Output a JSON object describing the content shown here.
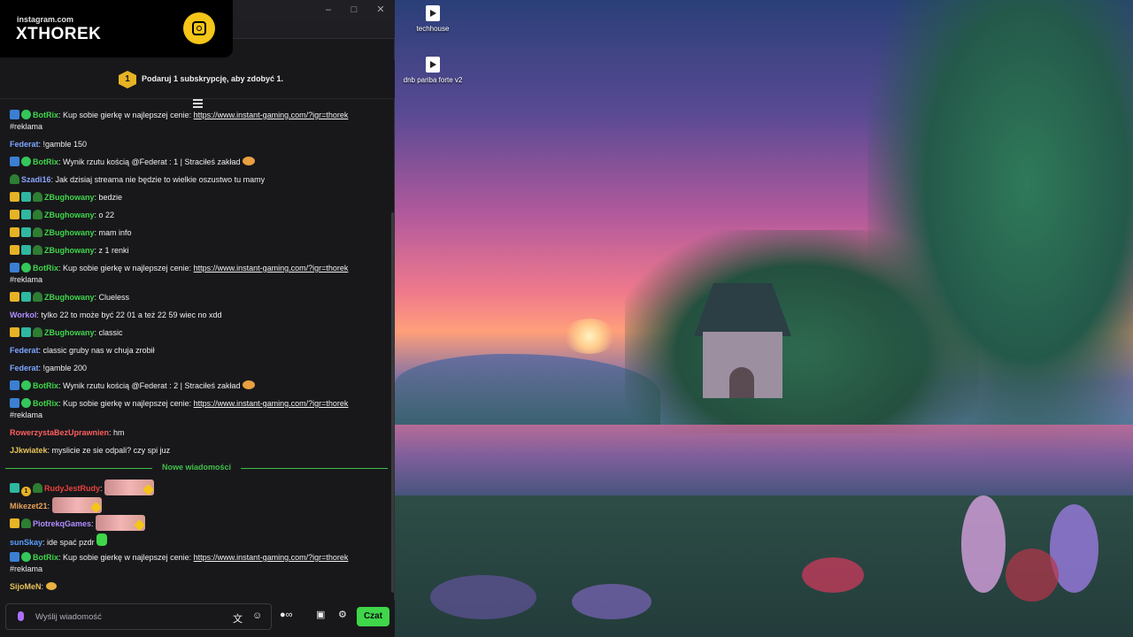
{
  "overlay": {
    "small": "instagram.com",
    "big": "XTHOREK",
    "logo_icon": "instagram-icon"
  },
  "gift": {
    "badge": "1",
    "text": "Podaruj 1 subskrypcję, aby zdobyć 1."
  },
  "desktop": {
    "icons": [
      {
        "label": "techhouse",
        "icon": "media-file-icon"
      },
      {
        "label": "dnb pariba forte v2",
        "icon": "media-file-icon"
      }
    ]
  },
  "colors": {
    "botrix": "#3fd64a",
    "federat": "#7ea6ff",
    "zbugh": "#3fd64a",
    "szadi": "#8aa6ff",
    "workol": "#b08cff",
    "rower": "#ff5e5e",
    "jjk": "#e8c35a",
    "rudy": "#e8413c",
    "mikezet": "#e8a35a",
    "piotrek": "#b08cff",
    "sunskay": "#5aa0ff",
    "sijomen": "#e8c35a",
    "accent": "#3fd64a"
  },
  "messages": [
    {
      "user": "BotRix",
      "text": "Kup sobie gierkę w najlepszej cenie: ",
      "link": "https://www.instant-gaming.com/?igr=thorek",
      "cont": "#reklama"
    },
    {
      "user": "Federat",
      "text": "!gamble 150"
    },
    {
      "user": "BotRix",
      "text": "Wynik rzutu kością @Federat : 1 | Straciłeś zakład"
    },
    {
      "user": "Szadi16",
      "text": "Jak dzisiaj streama nie będzie to wielkie oszustwo tu mamy"
    },
    {
      "user": "ZBughowany",
      "text": "bedzie"
    },
    {
      "user": "ZBughowany",
      "text": "o 22"
    },
    {
      "user": "ZBughowany",
      "text": "mam info"
    },
    {
      "user": "ZBughowany",
      "text": "z 1 renki"
    },
    {
      "user": "BotRix",
      "text": "Kup sobie gierkę w najlepszej cenie: ",
      "link": "https://www.instant-gaming.com/?igr=thorek",
      "cont": "#reklama"
    },
    {
      "user": "ZBughowany",
      "text": "Clueless"
    },
    {
      "user": "Workol",
      "text": "tylko 22 to może być 22 01 a też 22 59 wiec no xdd"
    },
    {
      "user": "ZBughowany",
      "text": "classic"
    },
    {
      "user": "Federat",
      "text": "classic gruby nas w chuja zrobił"
    },
    {
      "user": "Federat",
      "text": "!gamble 200"
    },
    {
      "user": "BotRix",
      "text": "Wynik rzutu kością @Federat : 2 | Straciłeś zakład"
    },
    {
      "user": "BotRix",
      "text": "Kup sobie gierkę w najlepszej cenie: ",
      "link": "https://www.instant-gaming.com/?igr=thorek",
      "cont": "#reklama"
    },
    {
      "user": "RowerzystaBezUprawnien",
      "text": "hm"
    },
    {
      "user": "JJkwiatek",
      "text": "myslicie ze sie odpali? czy spi juz"
    },
    {
      "user": "RudyJestRudy",
      "text": ""
    },
    {
      "user": "Mikezet21",
      "text": ""
    },
    {
      "user": "PiotrekqGames",
      "text": ""
    },
    {
      "user": "sunSkay",
      "text": "ide spać pzdr"
    },
    {
      "user": "BotRix",
      "text": "Kup sobie gierkę w najlepszej cenie: ",
      "link": "https://www.instant-gaming.com/?igr=thorek",
      "cont": "#reklama"
    },
    {
      "user": "SijoMeN",
      "text": ""
    }
  ],
  "divider": "Nowe wiadomości",
  "input": {
    "placeholder": "Wyślij wiadomość",
    "send_label": "Czat"
  }
}
